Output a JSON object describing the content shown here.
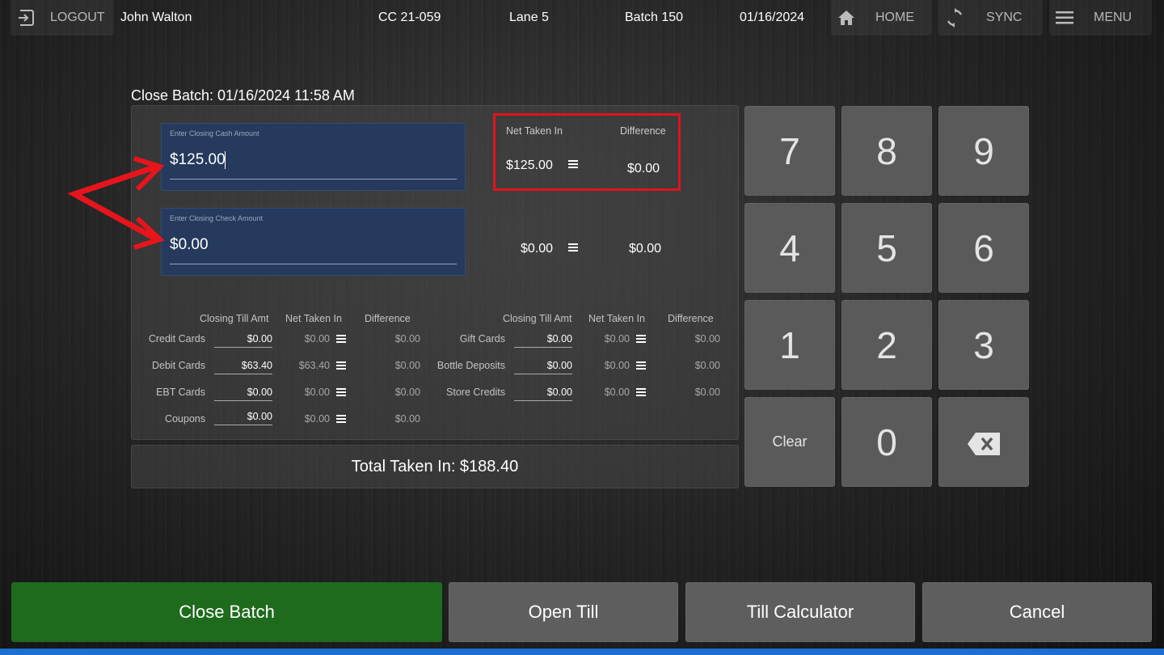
{
  "header": {
    "logout_label": "LOGOUT",
    "user_name": "John Walton",
    "store_code": "CC 21-059",
    "lane": "Lane 5",
    "batch": "Batch 150",
    "date": "01/16/2024",
    "home_label": "HOME",
    "sync_label": "SYNC",
    "menu_label": "MENU"
  },
  "close_batch": {
    "title": "Close Batch: 01/16/2024 11:58 AM",
    "cash": {
      "placeholder": "Enter Closing Cash Amount",
      "value": "$125.00",
      "net_taken_in": "$125.00",
      "difference": "$0.00"
    },
    "check": {
      "placeholder": "Enter Closing Check Amount",
      "value": "$0.00",
      "net_taken_in": "$0.00",
      "difference": "$0.00"
    },
    "net_header": "Net Taken In",
    "diff_header": "Difference",
    "table_headers": {
      "closing": "Closing Till Amt",
      "net": "Net Taken In",
      "diff": "Difference"
    },
    "left_rows": [
      {
        "label": "Credit Cards",
        "closing": "$0.00",
        "net": "$0.00",
        "diff": "$0.00"
      },
      {
        "label": "Debit Cards",
        "closing": "$63.40",
        "net": "$63.40",
        "diff": "$0.00"
      },
      {
        "label": "EBT Cards",
        "closing": "$0.00",
        "net": "$0.00",
        "diff": "$0.00"
      },
      {
        "label": "Coupons",
        "closing": "$0.00",
        "net": "$0.00",
        "diff": "$0.00"
      }
    ],
    "right_rows": [
      {
        "label": "Gift Cards",
        "closing": "$0.00",
        "net": "$0.00",
        "diff": "$0.00"
      },
      {
        "label": "Bottle Deposits",
        "closing": "$0.00",
        "net": "$0.00",
        "diff": "$0.00"
      },
      {
        "label": "Store Credits",
        "closing": "$0.00",
        "net": "$0.00",
        "diff": "$0.00"
      }
    ],
    "total_label": "Total Taken In: $188.40"
  },
  "keypad": {
    "keys": [
      "7",
      "8",
      "9",
      "4",
      "5",
      "6",
      "1",
      "2",
      "3",
      "Clear",
      "0"
    ]
  },
  "actions": {
    "close_batch": "Close Batch",
    "open_till": "Open Till",
    "till_calculator": "Till Calculator",
    "cancel": "Cancel"
  },
  "colors": {
    "highlight_box": "#e0141c",
    "arrow": "#e8141c",
    "close_batch_button": "#1f6b1e",
    "input_bg": "#253a5c"
  }
}
